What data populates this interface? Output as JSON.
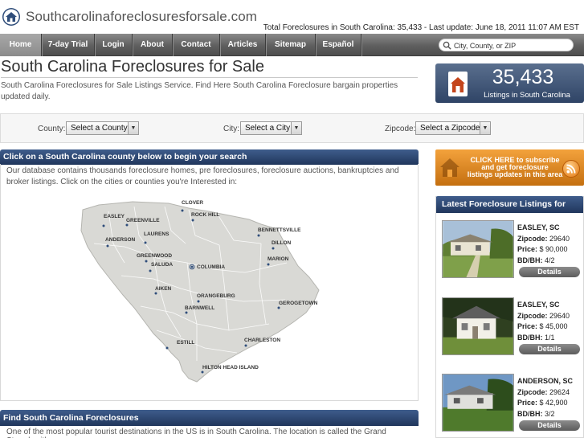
{
  "header": {
    "site_title": "Southcarolinaforeclosuresforsale.com",
    "stats": "Total Foreclosures in South Carolina: 35,433 - Last update: June 18, 2011 11:07 AM  EST"
  },
  "nav": {
    "items": [
      "Home",
      "7-day Trial",
      "Login",
      "About",
      "Contact",
      "Articles",
      "Sitemap",
      "Español"
    ],
    "search_placeholder": "City, County, or ZIP"
  },
  "main": {
    "title": "South Carolina Foreclosures for Sale",
    "intro": "South Carolina Foreclosures for Sale Listings Service. Find Here South Carolina Foreclosure bargain properties updated daily."
  },
  "count_badge": {
    "number": "35,433",
    "label": "Listings in South Carolina"
  },
  "filters": {
    "county_label": "County:",
    "county_value": "Select a County",
    "city_label": "City:",
    "city_value": "Select a City",
    "zip_label": "Zipcode:",
    "zip_value": "Select a Zipcode"
  },
  "county_section": {
    "heading": "Click on a South Carolina county below to begin your search",
    "text": "Our database contains thousands foreclosure homes, pre foreclosures, foreclosure auctions, bankruptcies and broker listings. Click on the cities or counties you're Interested in:",
    "cities": [
      "CLOVER",
      "ROCK HILL",
      "EASLEY",
      "GREENVILLE",
      "BENNETTSVILLE",
      "LAURENS",
      "ANDERSON",
      "DILLON",
      "GREENWOOD",
      "MARION",
      "SALUDA",
      "COLUMBIA",
      "AIKEN",
      "ORANGEBURG",
      "GEROGETOWN",
      "BARNWELL",
      "CHARLESTON",
      "ESTILL",
      "HILTON HEAD ISLAND"
    ]
  },
  "find_section": {
    "heading": "Find South Carolina Foreclosures",
    "text": "One of the most popular tourist destinations in the US is in South Carolina. The location is called the Grand Strand, with"
  },
  "subscribe": {
    "line1": "CLICK HERE to subscribe",
    "line2": "and get foreclosure",
    "line3": "listings updates in this area"
  },
  "latest": {
    "heading": "Latest Foreclosure Listings for Sale",
    "zip_label": "Zipcode:",
    "price_label": "Price:",
    "bdbh_label": "BD/BH:",
    "button": "Details",
    "listings": [
      {
        "city": "EASLEY, SC",
        "zip": "29640",
        "price": "$ 90,000",
        "bdbh": "4/2"
      },
      {
        "city": "EASLEY, SC",
        "zip": "29640",
        "price": "$ 45,000",
        "bdbh": "1/1"
      },
      {
        "city": "ANDERSON, SC",
        "zip": "29624",
        "price": "$ 42,900",
        "bdbh": "3/2"
      }
    ]
  },
  "colors": {
    "nav_dark": "#4e4e4e",
    "section_blue": "#20365c",
    "badge_blue": "#2f4466",
    "subscribe_orange": "#e08a22"
  }
}
